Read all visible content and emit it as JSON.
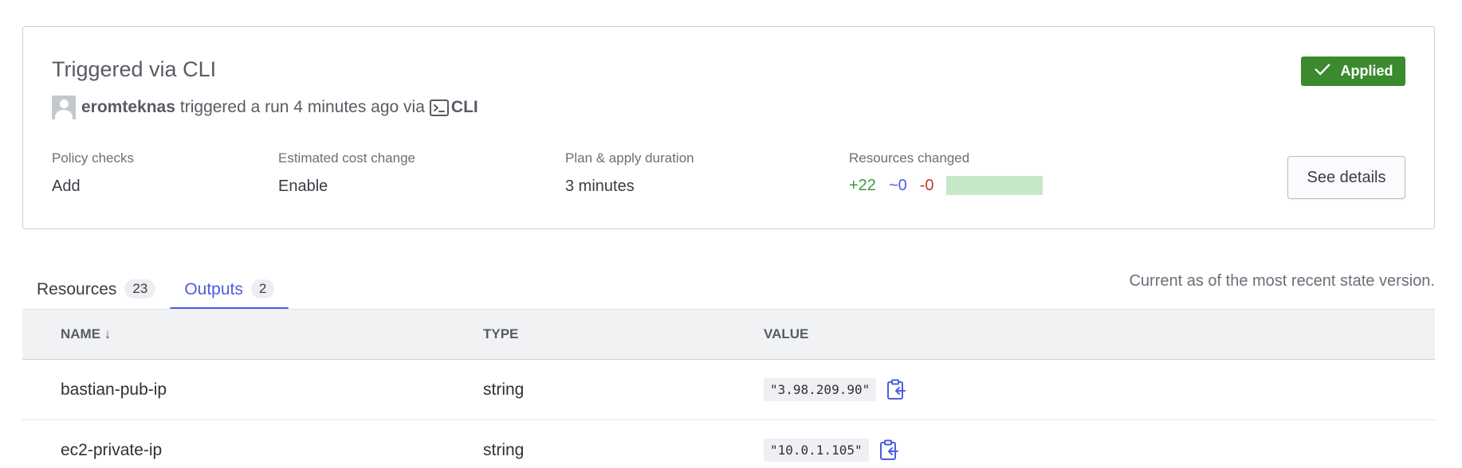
{
  "run": {
    "title": "Triggered via CLI",
    "status": "Applied",
    "user": "eromteknas",
    "action_text": "triggered a run 4 minutes ago via",
    "via": "CLI"
  },
  "stats": {
    "policy": {
      "label": "Policy checks",
      "value": "Add"
    },
    "cost": {
      "label": "Estimated cost change",
      "value": "Enable"
    },
    "duration": {
      "label": "Plan & apply duration",
      "value": "3 minutes"
    },
    "resources": {
      "label": "Resources changed",
      "add": "+22",
      "change": "~0",
      "destroy": "-0"
    }
  },
  "details_button": "See details",
  "tabs": [
    {
      "label": "Resources",
      "count": "23"
    },
    {
      "label": "Outputs",
      "count": "2"
    }
  ],
  "state_note": "Current as of the most recent state version.",
  "table": {
    "headers": [
      "NAME ↓",
      "TYPE",
      "VALUE"
    ],
    "rows": [
      {
        "name": "bastian-pub-ip",
        "type": "string",
        "value": "\"3.98.209.90\""
      },
      {
        "name": "ec2-private-ip",
        "type": "string",
        "value": "\"10.0.1.105\""
      }
    ]
  },
  "colors": {
    "accent": "#4d5de0",
    "applied": "#3b8a2e",
    "add": "#3d9a3d",
    "destroy": "#c0392b"
  },
  "icons": {
    "status": "check-icon",
    "via": "terminal-icon",
    "copy": "copy-to-clipboard-icon"
  }
}
